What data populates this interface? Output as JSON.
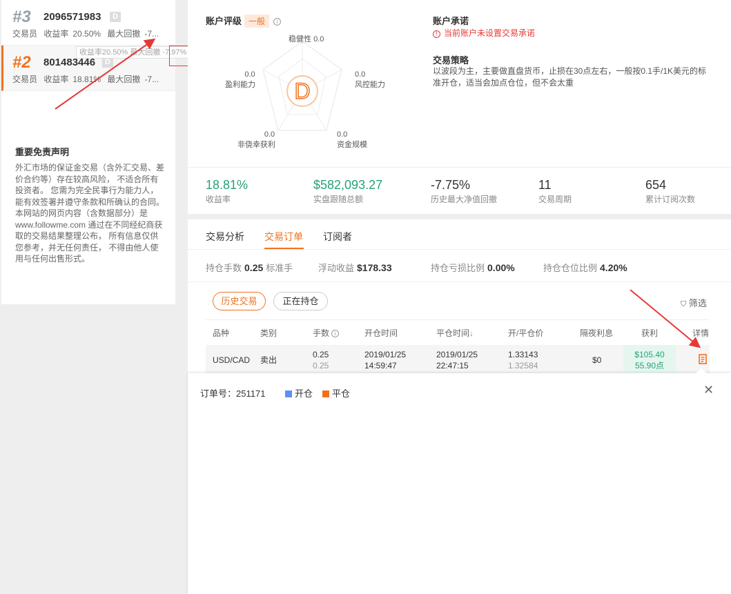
{
  "traders": [
    {
      "rank": "#3",
      "id": "2096571983",
      "tag": "D",
      "role": "交易员",
      "yield_label": "收益率",
      "yield": "20.50%",
      "drawdown_label": "最大回撤",
      "drawdown": "-7..."
    },
    {
      "rank": "#2",
      "id": "801483446",
      "tag": "D",
      "role": "交易员",
      "yield_label": "收益率",
      "yield": "18.81%",
      "drawdown_label": "最大回撤",
      "drawdown": "-7..."
    }
  ],
  "tooltip": {
    "text": "收益率20.50%  最大回撤",
    "value": "-7.97%"
  },
  "disclaimer": {
    "title": "重要免责声明",
    "body": "外汇市场的保证金交易（含外汇交易、差价合约等）存在较高风险， 不适合所有投资者。 您需为完全民事行为能力人， 能有效签署并遵守条款和所确认的合同。 本网站的网页内容（含数据部分）是 www.followme.com 通过在不同经纪商获取的交易结果整理公布， 所有信息仅供您参考，并无任何责任， 不得由他人使用与任何出售形式。"
  },
  "rating": {
    "label": "账户评级",
    "badge": "一般",
    "grade": "D",
    "axes": [
      {
        "name": "稳健性",
        "value": "0.0"
      },
      {
        "name": "风控能力",
        "value": "0.0"
      },
      {
        "name": "资金规模",
        "value": "0.0"
      },
      {
        "name": "非侥幸获利",
        "value": "0.0"
      },
      {
        "name": "盈利能力",
        "value": "0.0"
      }
    ]
  },
  "commitment": {
    "title": "账户承诺",
    "warning": "当前账户未设置交易承诺"
  },
  "strategy": {
    "title": "交易策略",
    "text": "以波段为主，主要做直盘货币，止损在30点左右，一般按0.1手/1K美元的标准开仓，适当会加点仓位，但不会太重"
  },
  "stats": [
    {
      "value": "18.81%",
      "label": "收益率"
    },
    {
      "value": "$582,093.27",
      "label": "实盘跟随总额"
    },
    {
      "value": "-7.75%",
      "label": "历史最大净值回撤"
    },
    {
      "value": "11",
      "label": "交易周期"
    },
    {
      "value": "654",
      "label": "累计订阅次数"
    }
  ],
  "tabs": [
    "交易分析",
    "交易订单",
    "订阅者"
  ],
  "summary": [
    {
      "label": "持仓手数",
      "value": "0.25",
      "unit": "标准手"
    },
    {
      "label": "浮动收益",
      "value": "$178.33",
      "unit": ""
    },
    {
      "label": "持仓亏损比例",
      "value": "0.00%",
      "unit": ""
    },
    {
      "label": "持仓仓位比例",
      "value": "4.20%",
      "unit": ""
    }
  ],
  "filters": {
    "history": "历史交易",
    "open": "正在持仓",
    "screen": "筛选"
  },
  "table": {
    "headers": [
      "品种",
      "类别",
      "手数",
      "开仓时间",
      "平仓时间",
      "开/平仓价",
      "隔夜利息",
      "获利",
      "详情"
    ],
    "row": {
      "symbol": "USD/CAD",
      "type": "卖出",
      "lots": "0.25",
      "lots_sub": "0.25",
      "open_date": "2019/01/25",
      "open_time": "14:59:47",
      "close_date": "2019/01/25",
      "close_time": "22:47:15",
      "open_price": "1.33143",
      "close_price": "1.32584",
      "swap": "$0",
      "profit": "$105.40",
      "points": "55.90点"
    }
  },
  "popup": {
    "order_label": "订单号：",
    "order_no": "251171",
    "legend_open": "开仓",
    "legend_close": "平仓",
    "color_open": "#5b8ff9",
    "color_close": "#f2711c"
  }
}
